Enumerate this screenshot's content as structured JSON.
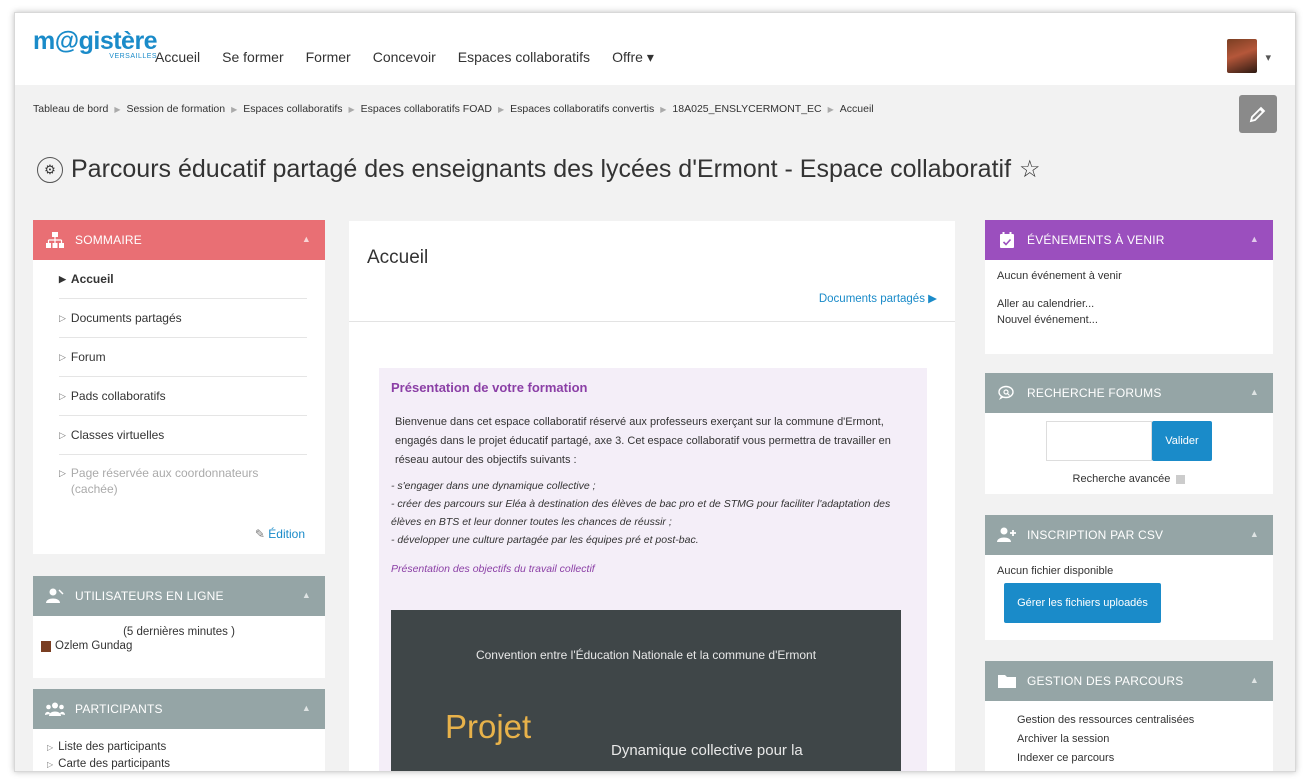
{
  "app": {
    "logo_main": "m@gistère",
    "logo_sub": "VERSAILLES",
    "nav": [
      "Accueil",
      "Se former",
      "Former",
      "Concevoir",
      "Espaces collaboratifs",
      "Offre ▾"
    ]
  },
  "breadcrumb": [
    "Tableau de bord",
    "Session de formation",
    "Espaces collaboratifs",
    "Espaces collaboratifs FOAD",
    "Espaces collaboratifs convertis",
    "18A025_ENSLYCERMONT_EC",
    "Accueil"
  ],
  "page_title": "Parcours éducatif partagé des enseignants des lycées d'Ermont - Espace collaboratif",
  "sommaire": {
    "title": "SOMMAIRE",
    "items": [
      "Accueil",
      "Documents partagés",
      "Forum",
      "Pads collaboratifs",
      "Classes virtuelles",
      "Page réservée aux coordonnateurs (cachée)"
    ],
    "edition": "Édition"
  },
  "online_users": {
    "title": "UTILISATEURS EN LIGNE",
    "period": "(5 dernières minutes )",
    "user": "Ozlem Gundag"
  },
  "participants": {
    "title": "PARTICIPANTS",
    "items": [
      "Liste des participants",
      "Carte des participants"
    ]
  },
  "center": {
    "title": "Accueil",
    "docs_link": "Documents partagés ▶",
    "pres_title": "Présentation de votre formation",
    "pres_body": "Bienvenue dans cet espace collaboratif réservé aux professeurs exerçant sur la commune d'Ermont, engagés dans le projet éducatif partagé, axe 3. Cet espace collaboratif vous permettra de travailler en réseau autour des objectifs suivants :",
    "pres_list": [
      "- s'engager dans une dynamique collective ;",
      "- créer des parcours sur Eléa à destination des élèves de bac pro et de STMG pour faciliter l'adaptation des élèves en BTS et leur donner toutes les chances de réussir ;",
      "- développer une culture partagée par les équipes pré et post-bac."
    ],
    "pres_sub": "Présentation des objectifs du travail collectif",
    "slide_head": "Convention entre l'Éducation Nationale et la commune d'Ermont",
    "slide_big": "Projet",
    "slide_text": "Dynamique collective pour la"
  },
  "events": {
    "title": "ÉVÉNEMENTS À VENIR",
    "none": "Aucun événement à venir",
    "link1": "Aller au calendrier...",
    "link2": "Nouvel événement..."
  },
  "search_forums": {
    "title": "RECHERCHE FORUMS",
    "button": "Valider",
    "advanced": "Recherche avancée"
  },
  "csv": {
    "title": "INSCRIPTION PAR CSV",
    "none": "Aucun fichier disponible",
    "button": "Gérer les fichiers uploadés"
  },
  "gestion": {
    "title": "GESTION DES PARCOURS",
    "items": [
      "Gestion des ressources centralisées",
      "Archiver la session",
      "Indexer ce parcours"
    ]
  },
  "colors": {
    "sommaire": "#e96f74",
    "grey_head": "#95a5a6",
    "events": "#9b4fbe",
    "link": "#1a8bc9",
    "slide_bg": "#3f4648",
    "slide_accent": "#e8b24a"
  }
}
